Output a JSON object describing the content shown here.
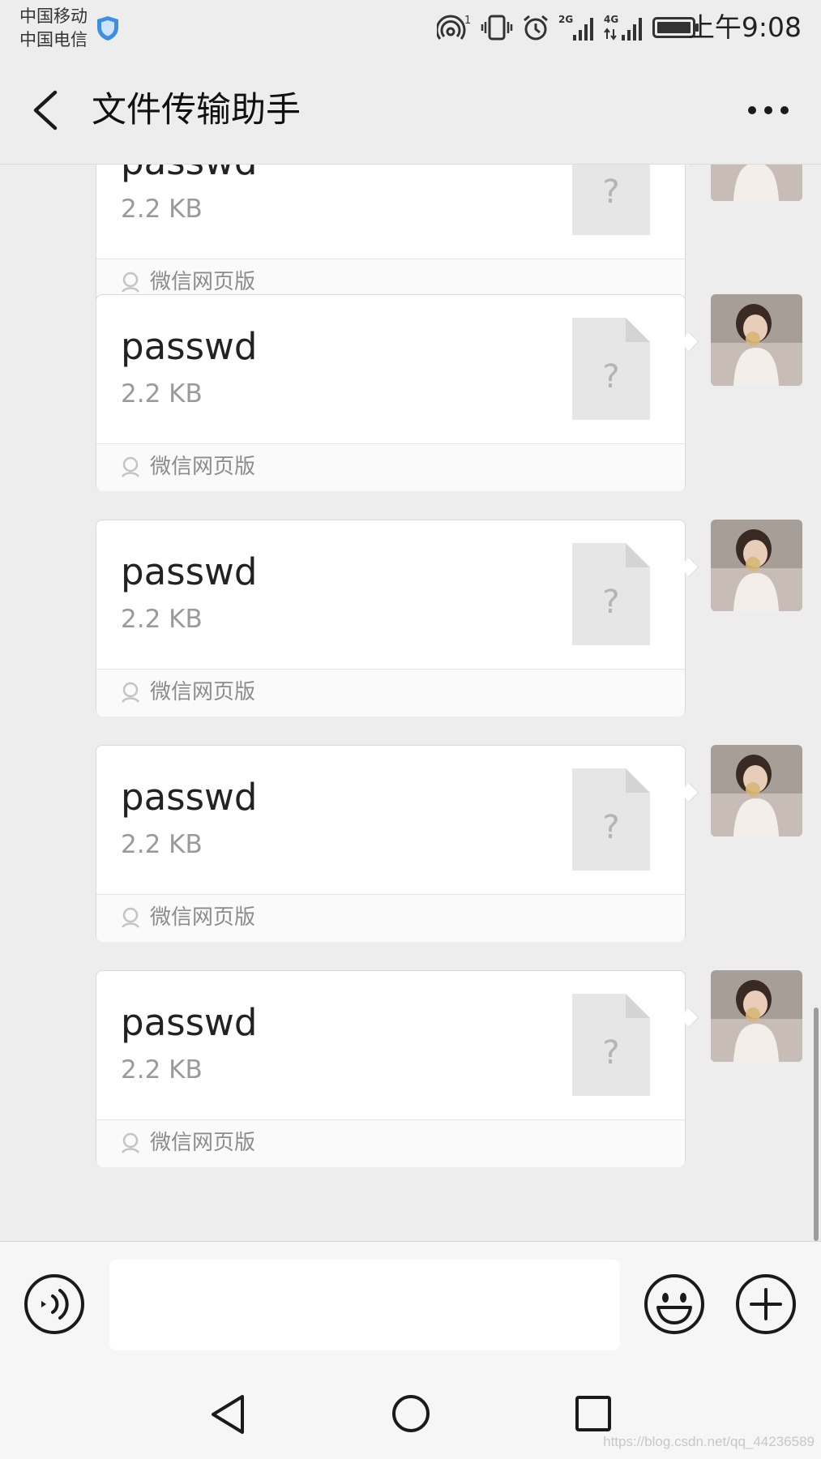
{
  "status_bar": {
    "carrier_1": "中国移动",
    "carrier_2": "中国电信",
    "signal_1_label": "2G",
    "signal_2_label": "4G",
    "hotspot_badge": "1",
    "time": "上午9:08"
  },
  "header": {
    "title": "文件传输助手"
  },
  "messages": [
    {
      "file_name": "passwd",
      "file_size": "2.2 KB",
      "file_icon_glyph": "?",
      "source": "微信网页版"
    },
    {
      "file_name": "passwd",
      "file_size": "2.2 KB",
      "file_icon_glyph": "?",
      "source": "微信网页版"
    },
    {
      "file_name": "passwd",
      "file_size": "2.2 KB",
      "file_icon_glyph": "?",
      "source": "微信网页版"
    },
    {
      "file_name": "passwd",
      "file_size": "2.2 KB",
      "file_icon_glyph": "?",
      "source": "微信网页版"
    },
    {
      "file_name": "passwd",
      "file_size": "2.2 KB",
      "file_icon_glyph": "?",
      "source": "微信网页版"
    }
  ],
  "input": {
    "value": "",
    "placeholder": ""
  },
  "watermark": "https://blog.csdn.net/qq_44236589",
  "colors": {
    "background": "#ededed",
    "card": "#ffffff",
    "muted_text": "#9a9a9a",
    "file_icon": "#e6e6e6"
  },
  "icons": {
    "back": "chevron-left-icon",
    "more": "more-dots-icon",
    "voice": "voice-icon",
    "emoji": "emoji-icon",
    "plus": "plus-icon"
  }
}
